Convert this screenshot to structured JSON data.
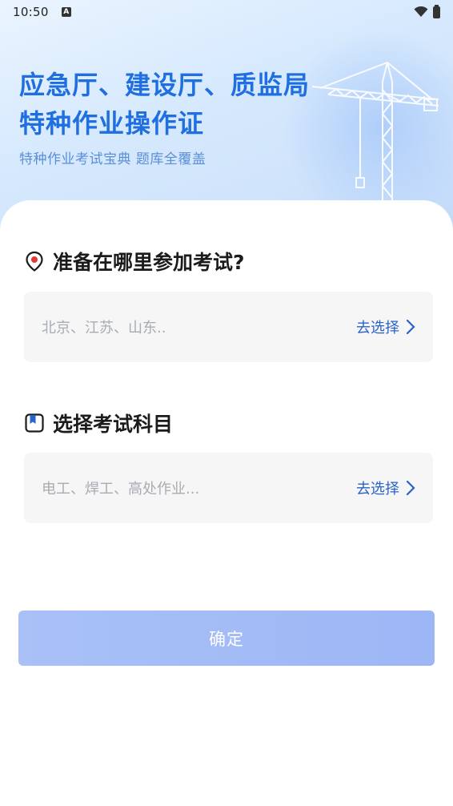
{
  "status_bar": {
    "time": "10:50",
    "notification_icon": "a-letter-icon",
    "wifi_icon": "wifi-icon",
    "battery_icon": "battery-icon"
  },
  "hero": {
    "title_line1": "应急厅、建设厅、质监局",
    "title_line2": "特种作业操作证",
    "subtitle": "特种作业考试宝典 题库全覆盖",
    "illustration": "tower-crane-icon"
  },
  "location_section": {
    "title": "准备在哪里参加考试?",
    "icon": "location-pin-icon",
    "placeholder": "北京、江苏、山东..",
    "action_label": "去选择"
  },
  "subject_section": {
    "title": "选择考试科目",
    "icon": "bookmark-icon",
    "placeholder": "电工、焊工、高处作业...",
    "action_label": "去选择"
  },
  "confirm_button": {
    "label": "确定"
  },
  "colors": {
    "accent": "#1f6fe0",
    "link": "#2a62c9",
    "button": "#a9c1f7",
    "pin_red": "#e53935"
  }
}
